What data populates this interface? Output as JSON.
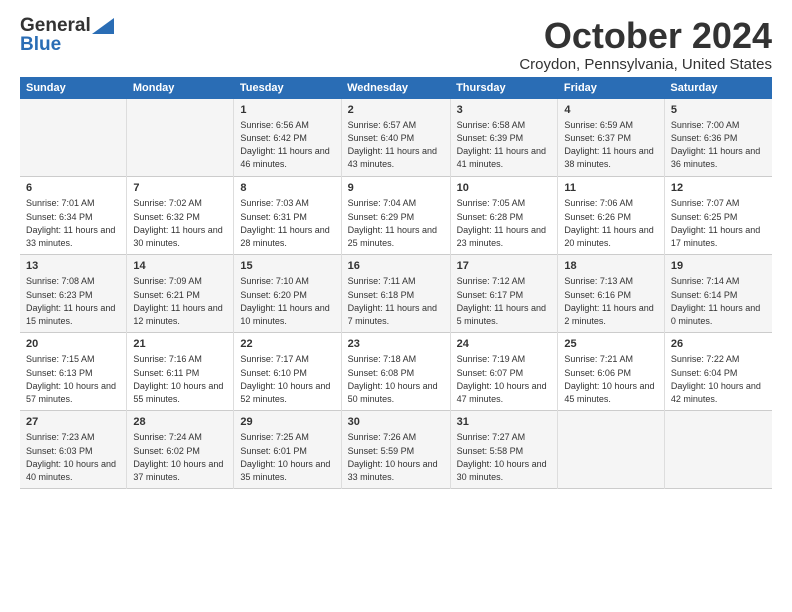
{
  "header": {
    "logo_general": "General",
    "logo_blue": "Blue",
    "month_title": "October 2024",
    "location": "Croydon, Pennsylvania, United States"
  },
  "columns": [
    "Sunday",
    "Monday",
    "Tuesday",
    "Wednesday",
    "Thursday",
    "Friday",
    "Saturday"
  ],
  "weeks": [
    {
      "days": [
        {
          "num": "",
          "content": ""
        },
        {
          "num": "",
          "content": ""
        },
        {
          "num": "1",
          "content": "Sunrise: 6:56 AM\nSunset: 6:42 PM\nDaylight: 11 hours and 46 minutes."
        },
        {
          "num": "2",
          "content": "Sunrise: 6:57 AM\nSunset: 6:40 PM\nDaylight: 11 hours and 43 minutes."
        },
        {
          "num": "3",
          "content": "Sunrise: 6:58 AM\nSunset: 6:39 PM\nDaylight: 11 hours and 41 minutes."
        },
        {
          "num": "4",
          "content": "Sunrise: 6:59 AM\nSunset: 6:37 PM\nDaylight: 11 hours and 38 minutes."
        },
        {
          "num": "5",
          "content": "Sunrise: 7:00 AM\nSunset: 6:36 PM\nDaylight: 11 hours and 36 minutes."
        }
      ]
    },
    {
      "days": [
        {
          "num": "6",
          "content": "Sunrise: 7:01 AM\nSunset: 6:34 PM\nDaylight: 11 hours and 33 minutes."
        },
        {
          "num": "7",
          "content": "Sunrise: 7:02 AM\nSunset: 6:32 PM\nDaylight: 11 hours and 30 minutes."
        },
        {
          "num": "8",
          "content": "Sunrise: 7:03 AM\nSunset: 6:31 PM\nDaylight: 11 hours and 28 minutes."
        },
        {
          "num": "9",
          "content": "Sunrise: 7:04 AM\nSunset: 6:29 PM\nDaylight: 11 hours and 25 minutes."
        },
        {
          "num": "10",
          "content": "Sunrise: 7:05 AM\nSunset: 6:28 PM\nDaylight: 11 hours and 23 minutes."
        },
        {
          "num": "11",
          "content": "Sunrise: 7:06 AM\nSunset: 6:26 PM\nDaylight: 11 hours and 20 minutes."
        },
        {
          "num": "12",
          "content": "Sunrise: 7:07 AM\nSunset: 6:25 PM\nDaylight: 11 hours and 17 minutes."
        }
      ]
    },
    {
      "days": [
        {
          "num": "13",
          "content": "Sunrise: 7:08 AM\nSunset: 6:23 PM\nDaylight: 11 hours and 15 minutes."
        },
        {
          "num": "14",
          "content": "Sunrise: 7:09 AM\nSunset: 6:21 PM\nDaylight: 11 hours and 12 minutes."
        },
        {
          "num": "15",
          "content": "Sunrise: 7:10 AM\nSunset: 6:20 PM\nDaylight: 11 hours and 10 minutes."
        },
        {
          "num": "16",
          "content": "Sunrise: 7:11 AM\nSunset: 6:18 PM\nDaylight: 11 hours and 7 minutes."
        },
        {
          "num": "17",
          "content": "Sunrise: 7:12 AM\nSunset: 6:17 PM\nDaylight: 11 hours and 5 minutes."
        },
        {
          "num": "18",
          "content": "Sunrise: 7:13 AM\nSunset: 6:16 PM\nDaylight: 11 hours and 2 minutes."
        },
        {
          "num": "19",
          "content": "Sunrise: 7:14 AM\nSunset: 6:14 PM\nDaylight: 11 hours and 0 minutes."
        }
      ]
    },
    {
      "days": [
        {
          "num": "20",
          "content": "Sunrise: 7:15 AM\nSunset: 6:13 PM\nDaylight: 10 hours and 57 minutes."
        },
        {
          "num": "21",
          "content": "Sunrise: 7:16 AM\nSunset: 6:11 PM\nDaylight: 10 hours and 55 minutes."
        },
        {
          "num": "22",
          "content": "Sunrise: 7:17 AM\nSunset: 6:10 PM\nDaylight: 10 hours and 52 minutes."
        },
        {
          "num": "23",
          "content": "Sunrise: 7:18 AM\nSunset: 6:08 PM\nDaylight: 10 hours and 50 minutes."
        },
        {
          "num": "24",
          "content": "Sunrise: 7:19 AM\nSunset: 6:07 PM\nDaylight: 10 hours and 47 minutes."
        },
        {
          "num": "25",
          "content": "Sunrise: 7:21 AM\nSunset: 6:06 PM\nDaylight: 10 hours and 45 minutes."
        },
        {
          "num": "26",
          "content": "Sunrise: 7:22 AM\nSunset: 6:04 PM\nDaylight: 10 hours and 42 minutes."
        }
      ]
    },
    {
      "days": [
        {
          "num": "27",
          "content": "Sunrise: 7:23 AM\nSunset: 6:03 PM\nDaylight: 10 hours and 40 minutes."
        },
        {
          "num": "28",
          "content": "Sunrise: 7:24 AM\nSunset: 6:02 PM\nDaylight: 10 hours and 37 minutes."
        },
        {
          "num": "29",
          "content": "Sunrise: 7:25 AM\nSunset: 6:01 PM\nDaylight: 10 hours and 35 minutes."
        },
        {
          "num": "30",
          "content": "Sunrise: 7:26 AM\nSunset: 5:59 PM\nDaylight: 10 hours and 33 minutes."
        },
        {
          "num": "31",
          "content": "Sunrise: 7:27 AM\nSunset: 5:58 PM\nDaylight: 10 hours and 30 minutes."
        },
        {
          "num": "",
          "content": ""
        },
        {
          "num": "",
          "content": ""
        }
      ]
    }
  ]
}
